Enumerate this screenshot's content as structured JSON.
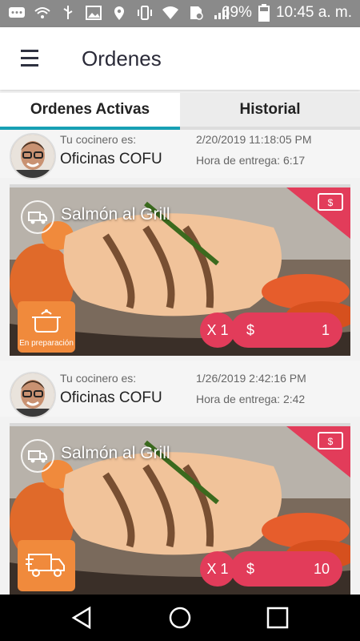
{
  "statusbar": {
    "battery": "69%",
    "time": "10:45 a. m."
  },
  "header": {
    "title": "Ordenes"
  },
  "tabs": [
    {
      "label": "Ordenes Activas"
    },
    {
      "label": "Historial"
    }
  ],
  "orders": [
    {
      "cook_label": "Tu cocinero es:",
      "cook_name": "Oficinas COFU",
      "date": "2/20/2019 11:18:05 PM",
      "delivery": "Hora de entrega: 6:17",
      "dish": "Salmón al Grill",
      "status_text": "En preparación",
      "qty": "X 1",
      "currency": "$",
      "amount": "1"
    },
    {
      "cook_label": "Tu cocinero es:",
      "cook_name": "Oficinas COFU",
      "date": "1/26/2019 2:42:16 PM",
      "delivery": "Hora de entrega: 2:42",
      "dish": "Salmón al Grill",
      "status_text": "",
      "qty": "X 1",
      "currency": "$",
      "amount": "10"
    }
  ],
  "colors": {
    "accent": "#18a0b4",
    "price": "#e23c5a",
    "status": "#f08a3c"
  }
}
